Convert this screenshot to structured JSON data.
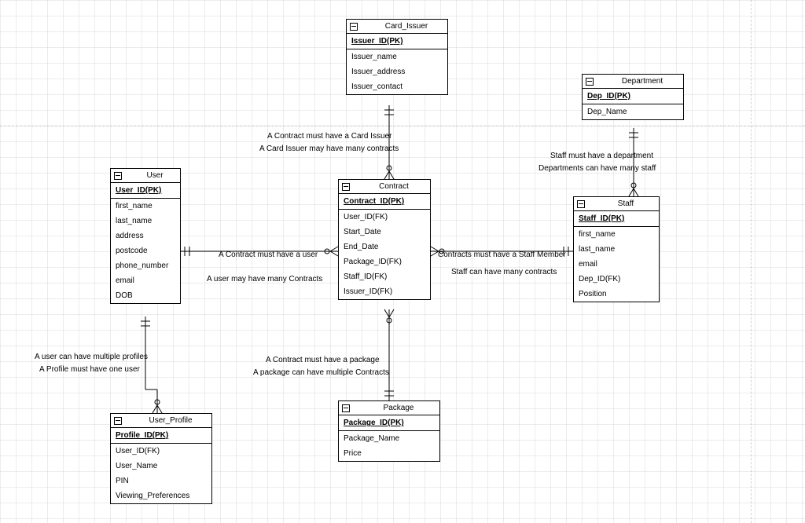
{
  "entities": {
    "card_issuer": {
      "name": "Card_Issuer",
      "pk": "Issuer_ID(PK)",
      "attrs": [
        "Issuer_name",
        "Issuer_address",
        "Issuer_contact"
      ]
    },
    "department": {
      "name": "Department",
      "pk": "Dep_ID(PK)",
      "attrs": [
        "Dep_Name"
      ]
    },
    "user": {
      "name": "User",
      "pk": "User_ID(PK)",
      "attrs": [
        "first_name",
        "last_name",
        "address",
        "postcode",
        "phone_number",
        "email",
        "DOB"
      ]
    },
    "contract": {
      "name": "Contract",
      "pk": "Contract_ID(PK)",
      "attrs": [
        "User_ID(FK)",
        "Start_Date",
        "End_Date",
        "Package_ID(FK)",
        "Staff_ID(FK)",
        "Issuer_ID(FK)"
      ]
    },
    "staff": {
      "name": "Staff",
      "pk": "Staff_ID(PK)",
      "attrs": [
        "first_name",
        "last_name",
        "email",
        "Dep_ID(FK)",
        "Position"
      ]
    },
    "user_profile": {
      "name": "User_Profile",
      "pk": "Profile_ID(PK)",
      "attrs": [
        "User_ID(FK)",
        "User_Name",
        "PIN",
        "Viewing_Preferences"
      ]
    },
    "package": {
      "name": "Package",
      "pk": "Package_ID(PK)",
      "attrs": [
        "Package_Name",
        "Price"
      ]
    }
  },
  "labels": {
    "rel_cardissuer_contract_1": "A Contract must have a Card Issuer",
    "rel_cardissuer_contract_2": "A Card Issuer may have many contracts",
    "rel_dept_staff_1": "Staff must have a department",
    "rel_dept_staff_2": "Departments can have many staff",
    "rel_user_contract_1": "A Contract must have a user",
    "rel_user_contract_2": "A user may have many Contracts",
    "rel_contract_staff_1": "Contracts must have a Staff Member",
    "rel_contract_staff_2": "Staff can have many contracts",
    "rel_contract_package_1": "A Contract must have a package",
    "rel_contract_package_2": "A package can have multiple Contracts",
    "rel_user_profile_1": "A user can have multiple profiles",
    "rel_user_profile_2": "A Profile must have one user"
  },
  "chart_data": {
    "type": "table",
    "diagram_kind": "entity-relationship",
    "entities": [
      {
        "name": "Card_Issuer",
        "primary_key": "Issuer_ID",
        "attributes": [
          "Issuer_name",
          "Issuer_address",
          "Issuer_contact"
        ]
      },
      {
        "name": "Department",
        "primary_key": "Dep_ID",
        "attributes": [
          "Dep_Name"
        ]
      },
      {
        "name": "User",
        "primary_key": "User_ID",
        "attributes": [
          "first_name",
          "last_name",
          "address",
          "postcode",
          "phone_number",
          "email",
          "DOB"
        ]
      },
      {
        "name": "Contract",
        "primary_key": "Contract_ID",
        "attributes": [
          "User_ID (FK)",
          "Start_Date",
          "End_Date",
          "Package_ID (FK)",
          "Staff_ID (FK)",
          "Issuer_ID (FK)"
        ]
      },
      {
        "name": "Staff",
        "primary_key": "Staff_ID",
        "attributes": [
          "first_name",
          "last_name",
          "email",
          "Dep_ID (FK)",
          "Position"
        ]
      },
      {
        "name": "User_Profile",
        "primary_key": "Profile_ID",
        "attributes": [
          "User_ID (FK)",
          "User_Name",
          "PIN",
          "Viewing_Preferences"
        ]
      },
      {
        "name": "Package",
        "primary_key": "Package_ID",
        "attributes": [
          "Package_Name",
          "Price"
        ]
      }
    ],
    "relationships": [
      {
        "from": "Contract",
        "to": "Card_Issuer",
        "from_card": "many",
        "to_card": "1",
        "notes": [
          "A Contract must have a Card Issuer",
          "A Card Issuer may have many contracts"
        ]
      },
      {
        "from": "Staff",
        "to": "Department",
        "from_card": "many",
        "to_card": "1",
        "notes": [
          "Staff must have a department",
          "Departments can have many staff"
        ]
      },
      {
        "from": "Contract",
        "to": "User",
        "from_card": "many",
        "to_card": "1",
        "notes": [
          "A Contract must have a user",
          "A user may have many Contracts"
        ]
      },
      {
        "from": "Contract",
        "to": "Staff",
        "from_card": "many",
        "to_card": "1",
        "notes": [
          "Contracts must have a Staff Member",
          "Staff can have many contracts"
        ]
      },
      {
        "from": "Contract",
        "to": "Package",
        "from_card": "many",
        "to_card": "1",
        "notes": [
          "A Contract must have a package",
          "A package can have multiple Contracts"
        ]
      },
      {
        "from": "User_Profile",
        "to": "User",
        "from_card": "many",
        "to_card": "1",
        "notes": [
          "A user can have multiple profiles",
          "A Profile must have one user"
        ]
      }
    ]
  }
}
